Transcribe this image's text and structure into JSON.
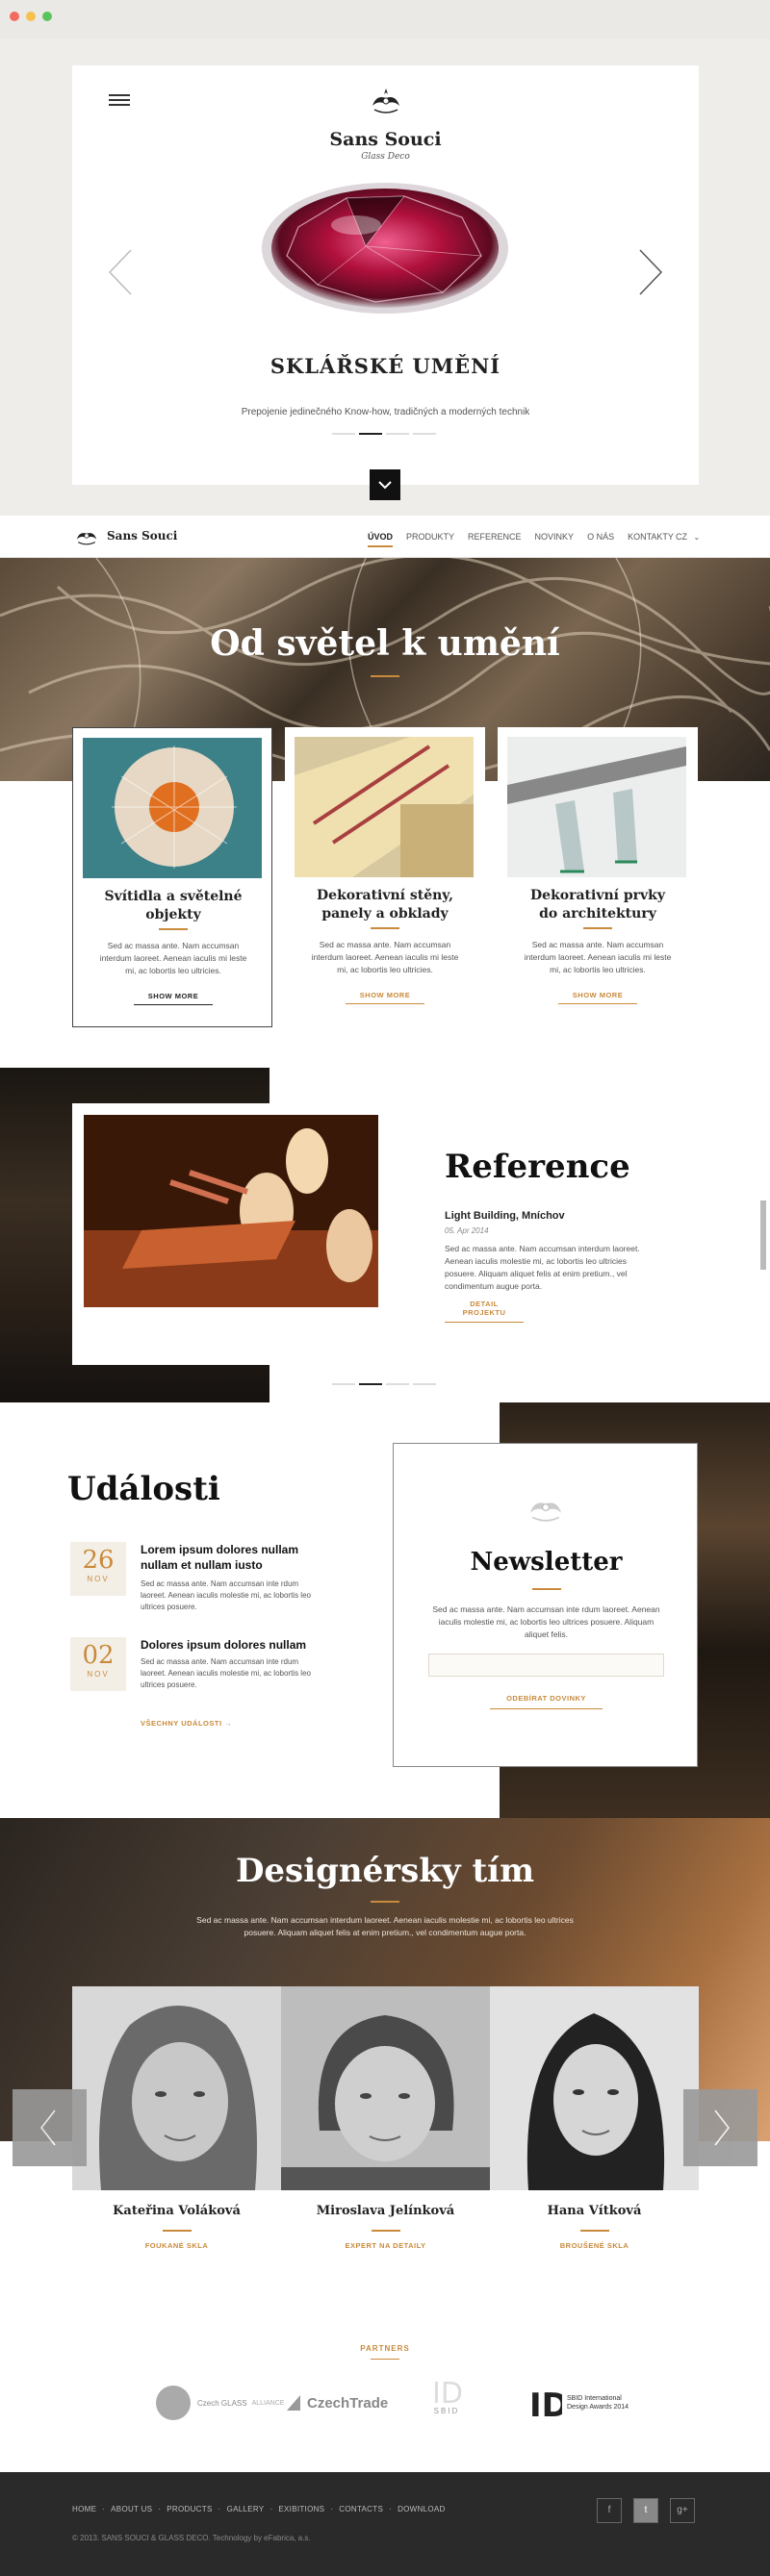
{
  "window": {
    "dot_colors": [
      "#f36b5e",
      "#f5c04f",
      "#58c45b"
    ]
  },
  "hero": {
    "brand": "Sans Souci",
    "brand_sub": "Glass Deco",
    "title": "SKLÁŘSKÉ UMĚNÍ",
    "subtitle": "Prepojenie jedinečného Know-how, tradičných a moderných technik",
    "slides": 4,
    "active_slide": 2
  },
  "nav": {
    "brand": "Sans Souci",
    "items": [
      "ÚVOD",
      "PRODUKTY",
      "REFERENCE",
      "NOVINKY",
      "O NÁS",
      "KONTAKTY"
    ],
    "active": "ÚVOD",
    "lang": "CZ"
  },
  "section1": {
    "title": "Od světel k umění",
    "cards": [
      {
        "title_l1": "Svítidla a světelné",
        "title_l2": "objekty",
        "text": "Sed ac massa ante. Nam accumsan interdum laoreet. Aenean iaculis mi leste mi, ac lobortis leo ultricies.",
        "button": "SHOW MORE"
      },
      {
        "title_l1": "Dekorativní stěny,",
        "title_l2": "panely a obklady",
        "text": "Sed ac massa ante. Nam accumsan interdum laoreet. Aenean iaculis mi leste mi, ac lobortis leo ultricies.",
        "button": "SHOW MORE"
      },
      {
        "title_l1": "Dekorativní prvky",
        "title_l2": "do architektury",
        "text": "Sed ac massa ante. Nam accumsan interdum laoreet. Aenean iaculis mi leste mi, ac lobortis leo ultricies.",
        "button": "SHOW MORE"
      }
    ]
  },
  "reference": {
    "title": "Reference",
    "item_title": "Light Building, Mníchov",
    "date": "05. Apr 2014",
    "text": "Sed ac massa ante. Nam accumsan interdum laoreet. Aenean iaculis molestie mi, ac lobortis leo ultricies posuere. Aliquam aliquet felis at enim pretium., vel condimentum augue porta.",
    "button": "DETAIL PROJEKTU"
  },
  "events": {
    "title": "Události",
    "items": [
      {
        "day": "26",
        "month": "NOV",
        "title": "Lorem ipsum dolores nullam nullam et nullam iusto",
        "text": "Sed ac massa ante. Nam accumsan inte rdum laoreet. Aenean iaculis molestie mi, ac lobortis leo ultrices posuere."
      },
      {
        "day": "02",
        "month": "NOV",
        "title": "Dolores ipsum dolores nullam",
        "text": "Sed ac massa ante. Nam accumsan inte rdum laoreet. Aenean iaculis molestie mi, ac lobortis leo ultrices posuere."
      }
    ],
    "all_link": "VŠECHNY UDÁLOSTI  →"
  },
  "newsletter": {
    "title": "Newsletter",
    "text": "Sed ac massa ante. Nam accumsan inte rdum laoreet. Aenean iaculis molestie mi, ac lobortis leo ultrices posuere. Aliquam aliquet felis.",
    "input_placeholder": "",
    "button": "ODEBÍRAT DOVINKY"
  },
  "team": {
    "title": "Designérsky tím",
    "text": "Sed ac massa ante. Nam accumsan interdum laoreet. Aenean iaculis molestie mi, ac lobortis leo ultrices posuere. Aliquam aliquet felis at enim pretium., vel condimentum augue porta.",
    "members": [
      {
        "name": "Kateřina Voláková",
        "role": "FOUKANÉ SKLA"
      },
      {
        "name": "Miroslava Jelínková",
        "role": "EXPERT NA DETAILY"
      },
      {
        "name": "Hana Vítková",
        "role": "BROUŠENÉ SKLA"
      }
    ]
  },
  "partners": {
    "label": "PARTNERS",
    "logos": [
      {
        "name": "Czech Glass",
        "text": "Czech GLASS",
        "sub": "ALLIANCE"
      },
      {
        "name": "CzechTrade",
        "text": "CzechTrade",
        "sub": ""
      },
      {
        "name": "SBID",
        "text": "SBID",
        "sub": ""
      },
      {
        "name": "SBID Awards",
        "text": "SBID International Design Awards 2014",
        "sub": ""
      }
    ]
  },
  "footer": {
    "nav": [
      "HOME",
      "ABOUT US",
      "PRODUCTS",
      "GALLERY",
      "EXIBITIONS",
      "CONTACTS",
      "DOWNLOAD"
    ],
    "copyright": "© 2013. SANS SOUCI & GLASS DECO. Technology by eFabrica, a.s.",
    "social": [
      "f",
      "t",
      "g+"
    ]
  },
  "colors": {
    "accent": "#c98a3c",
    "footer_bg": "#2a2a2a"
  }
}
